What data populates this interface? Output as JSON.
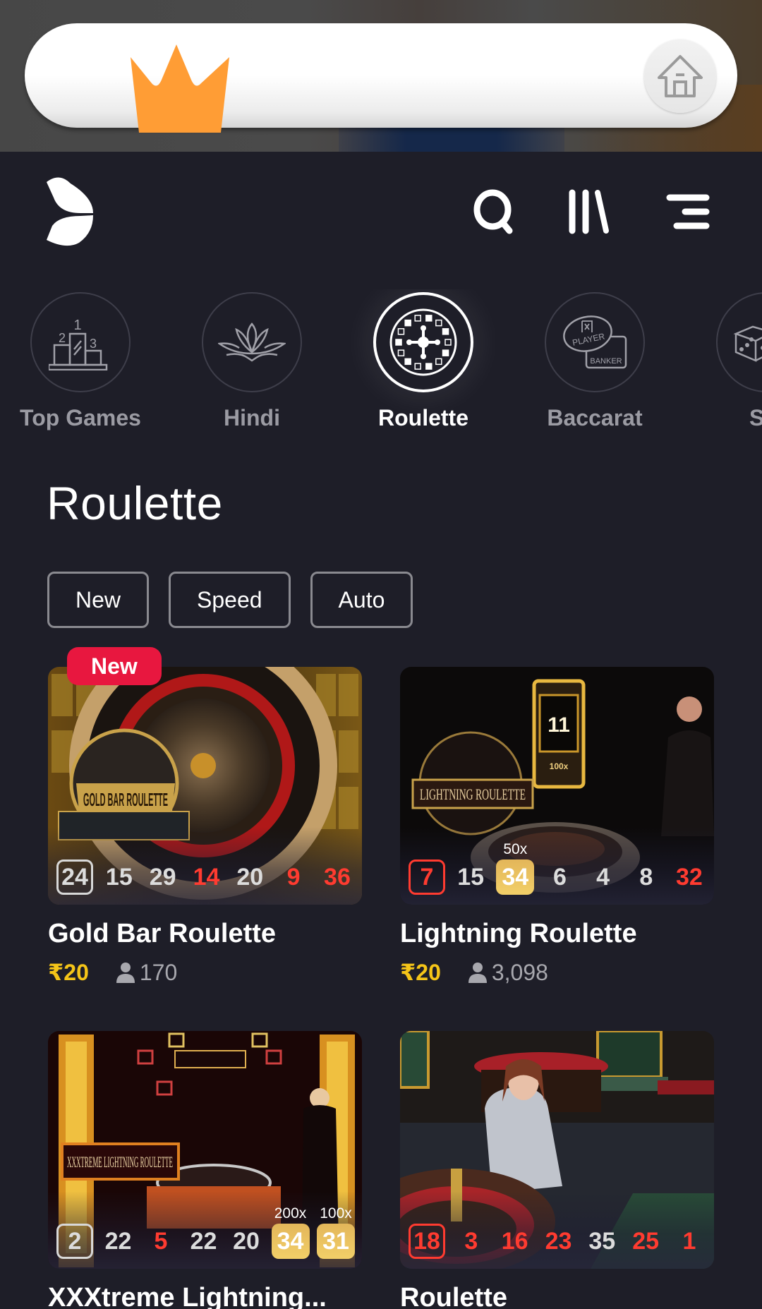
{
  "banner": {
    "crown_icon": "crown-icon",
    "home_icon": "home-icon",
    "crown_color": "#ff9d35"
  },
  "header": {
    "logo": "brand-logo",
    "icons": [
      "search-icon",
      "library-icon",
      "menu-icon"
    ]
  },
  "categories": [
    {
      "label": "Top Games",
      "icon": "podium-icon",
      "active": false
    },
    {
      "label": "Hindi",
      "icon": "lotus-icon",
      "active": false
    },
    {
      "label": "Roulette",
      "icon": "roulette-wheel-icon",
      "active": true
    },
    {
      "label": "Baccarat",
      "icon": "baccarat-icon",
      "active": false
    },
    {
      "label": "Sic",
      "icon": "dice-icon",
      "active": false
    }
  ],
  "baccarat_icon_text": {
    "player": "PLAYER",
    "banker": "BANKER"
  },
  "section": {
    "title": "Roulette",
    "filters": [
      "New",
      "Speed",
      "Auto"
    ]
  },
  "games": [
    {
      "title": "Gold Bar Roulette",
      "badge": "New",
      "price": "₹20",
      "players": "170",
      "art_label": "GOLD BAR ROULETTE",
      "results": [
        {
          "n": "24",
          "color": "white",
          "first": true
        },
        {
          "n": "15",
          "color": "white"
        },
        {
          "n": "29",
          "color": "white"
        },
        {
          "n": "14",
          "color": "red"
        },
        {
          "n": "20",
          "color": "white"
        },
        {
          "n": "9",
          "color": "red"
        },
        {
          "n": "36",
          "color": "red"
        }
      ]
    },
    {
      "title": "Lightning Roulette",
      "price": "₹20",
      "players": "3,098",
      "art_label": "LIGHTNING ROULETTE",
      "art_number": "11",
      "art_mult": "100x",
      "results": [
        {
          "n": "7",
          "color": "red",
          "first": true
        },
        {
          "n": "15",
          "color": "white"
        },
        {
          "n": "34",
          "color": "gold",
          "mult": "50x"
        },
        {
          "n": "6",
          "color": "white"
        },
        {
          "n": "4",
          "color": "white"
        },
        {
          "n": "8",
          "color": "white"
        },
        {
          "n": "32",
          "color": "red"
        }
      ]
    },
    {
      "title": "XXXtreme Lightning...",
      "art_label": "XXXTREME LIGHTNING ROULETTE",
      "results": [
        {
          "n": "2",
          "color": "white",
          "first": true
        },
        {
          "n": "22",
          "color": "white"
        },
        {
          "n": "5",
          "color": "red"
        },
        {
          "n": "22",
          "color": "white"
        },
        {
          "n": "20",
          "color": "white"
        },
        {
          "n": "34",
          "color": "gold",
          "mult": "200x"
        },
        {
          "n": "31",
          "color": "gold",
          "mult": "100x"
        }
      ]
    },
    {
      "title": "Roulette",
      "results": [
        {
          "n": "18",
          "color": "red",
          "first": true
        },
        {
          "n": "3",
          "color": "red"
        },
        {
          "n": "16",
          "color": "red"
        },
        {
          "n": "23",
          "color": "red"
        },
        {
          "n": "35",
          "color": "white"
        },
        {
          "n": "25",
          "color": "red"
        },
        {
          "n": "1",
          "color": "red"
        }
      ]
    }
  ],
  "colors": {
    "background": "#1e1e28",
    "price": "#f5c518",
    "red_number": "#ff3b30",
    "badge_new": "#e8173f",
    "gold_result": "#eec463"
  }
}
